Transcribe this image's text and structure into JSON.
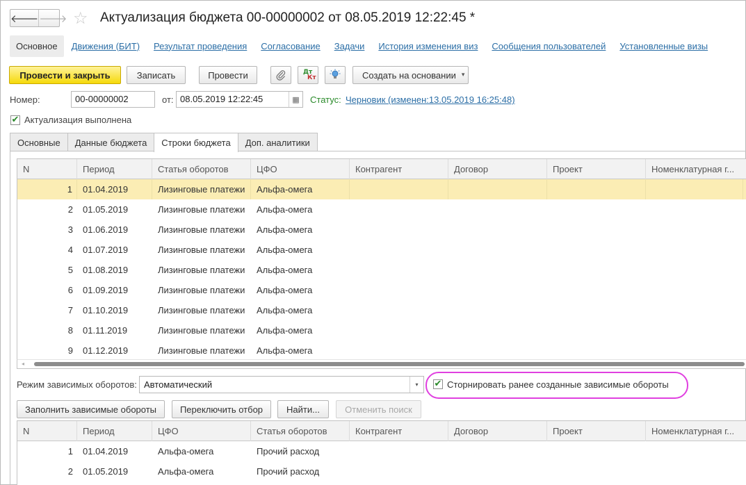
{
  "window": {
    "title": "Актуализация бюджета 00-00000002 от 08.05.2019 12:22:45 *",
    "back_glyph": "🡐",
    "forward_glyph": "🡒",
    "favorite_glyph": "☆"
  },
  "section_tabs": [
    {
      "label": "Основное"
    },
    {
      "label": "Движения (БИТ)"
    },
    {
      "label": "Результат проведения"
    },
    {
      "label": "Согласование"
    },
    {
      "label": "Задачи"
    },
    {
      "label": "История изменения виз"
    },
    {
      "label": "Сообщения пользователей"
    },
    {
      "label": "Установленные визы"
    }
  ],
  "toolbar": {
    "post_and_close": "Провести и закрыть",
    "write": "Записать",
    "post": "Провести",
    "attach_icon": "paperclip-icon",
    "dt_kt_top": "Дт",
    "dt_kt_bottom": "Кт",
    "hint_icon": "lightbulb-icon",
    "create_based_on": "Создать на основании",
    "dropdown_glyph": "▾"
  },
  "header": {
    "number_label": "Номер:",
    "number_value": "00-00000002",
    "from_label": "от:",
    "date_value": "08.05.2019 12:22:45",
    "calendar_glyph": "▦",
    "status_label": "Статус:",
    "status_value": "Черновик (изменен:13.05.2019 16:25:48)",
    "actualization_done_label": "Актуализация выполнена",
    "check_glyph": "✔"
  },
  "page_tabs": [
    {
      "label": "Основные"
    },
    {
      "label": "Данные бюджета"
    },
    {
      "label": "Строки бюджета"
    },
    {
      "label": "Доп. аналитики"
    }
  ],
  "budget_table": {
    "columns": [
      "N",
      "Период",
      "Статья оборотов",
      "ЦФО",
      "Контрагент",
      "Договор",
      "Проект",
      "Номенклатурная г..."
    ],
    "rows": [
      [
        "1",
        "01.04.2019",
        "Лизинговые платежи",
        "Альфа-омега",
        "",
        "",
        "",
        ""
      ],
      [
        "2",
        "01.05.2019",
        "Лизинговые платежи",
        "Альфа-омега",
        "",
        "",
        "",
        ""
      ],
      [
        "3",
        "01.06.2019",
        "Лизинговые платежи",
        "Альфа-омега",
        "",
        "",
        "",
        ""
      ],
      [
        "4",
        "01.07.2019",
        "Лизинговые платежи",
        "Альфа-омега",
        "",
        "",
        "",
        ""
      ],
      [
        "5",
        "01.08.2019",
        "Лизинговые платежи",
        "Альфа-омега",
        "",
        "",
        "",
        ""
      ],
      [
        "6",
        "01.09.2019",
        "Лизинговые платежи",
        "Альфа-омега",
        "",
        "",
        "",
        ""
      ],
      [
        "7",
        "01.10.2019",
        "Лизинговые платежи",
        "Альфа-омега",
        "",
        "",
        "",
        ""
      ],
      [
        "8",
        "01.11.2019",
        "Лизинговые платежи",
        "Альфа-омега",
        "",
        "",
        "",
        ""
      ],
      [
        "9",
        "01.12.2019",
        "Лизинговые платежи",
        "Альфа-омега",
        "",
        "",
        "",
        ""
      ]
    ],
    "scroll_left_glyph": "◂"
  },
  "dependent": {
    "mode_label": "Режим зависимых оборотов:",
    "mode_value": "Автоматический",
    "combo_glyph": "▾",
    "reverse_label": "Сторнировать ранее созданные зависимые обороты",
    "fill_button": "Заполнить зависимые обороты",
    "toggle_filter_button": "Переключить отбор",
    "find_button": "Найти...",
    "cancel_search_button": "Отменить поиск"
  },
  "dependent_table": {
    "columns": [
      "N",
      "Период",
      "ЦФО",
      "Статья оборотов",
      "Контрагент",
      "Договор",
      "Проект",
      "Номенклатурная г..."
    ],
    "rows": [
      [
        "1",
        "01.04.2019",
        "Альфа-омега",
        "Прочий расход",
        "",
        "",
        "",
        ""
      ],
      [
        "2",
        "01.05.2019",
        "Альфа-омега",
        "Прочий расход",
        "",
        "",
        "",
        ""
      ]
    ]
  },
  "colors": {
    "primary_button": "#f5d90a",
    "link": "#2b6ea6",
    "selected_row": "#fbedb4",
    "highlight_outline": "#e040e0",
    "check": "#2a8a2a"
  }
}
